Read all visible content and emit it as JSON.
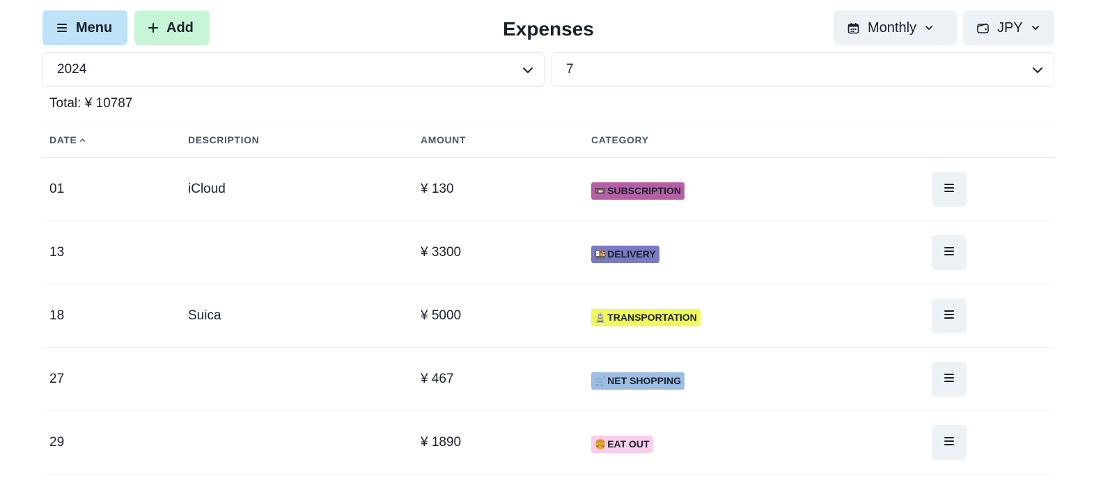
{
  "header": {
    "menu_label": "Menu",
    "add_label": "Add",
    "title": "Expenses",
    "period_label": "Monthly",
    "currency_label": "JPY"
  },
  "filters": {
    "year": "2024",
    "month": "7"
  },
  "summary": {
    "total": "Total: ¥ 10787"
  },
  "table": {
    "headers": {
      "date": "DATE",
      "description": "DESCRIPTION",
      "amount": "AMOUNT",
      "category": "CATEGORY"
    },
    "rows": [
      {
        "date": "01",
        "description": "iCloud",
        "amount": "¥ 130",
        "category": "SUBSCRIPTION",
        "emoji": "📼",
        "color": "#b65fa6"
      },
      {
        "date": "13",
        "description": "",
        "amount": "¥ 3300",
        "category": "DELIVERY",
        "emoji": "🍱",
        "color": "#7a7bc2"
      },
      {
        "date": "18",
        "description": "Suica",
        "amount": "¥ 5000",
        "category": "TRANSPORTATION",
        "emoji": "🚊",
        "color": "#f1f85a"
      },
      {
        "date": "27",
        "description": "",
        "amount": "¥ 467",
        "category": "NET SHOPPING",
        "emoji": "🛒",
        "color": "#9dbde2"
      },
      {
        "date": "29",
        "description": "",
        "amount": "¥ 1890",
        "category": "EAT OUT",
        "emoji": "🍔",
        "color": "#f9cdec"
      }
    ]
  },
  "icons": {
    "menu": "hamburger-icon",
    "add": "plus-icon",
    "period": "calendar-icon",
    "currency": "wallet-icon",
    "dropdown": "chevron-down-icon",
    "sort": "chevron-up-icon",
    "row_action": "hamburger-icon"
  },
  "colors": {
    "menu_button": "#bee3f8",
    "add_button": "#c6f6d5",
    "neutral_button": "#edf2f7",
    "header_text": "#4a5568"
  }
}
